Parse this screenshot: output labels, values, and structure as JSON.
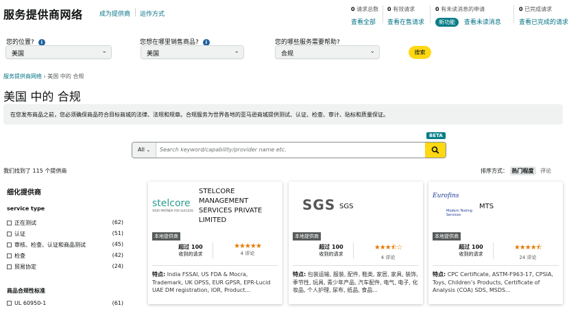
{
  "header": {
    "title": "服务提供商网络",
    "link1": "成为提供商",
    "link2": "运作方式",
    "stats": [
      {
        "count": "0",
        "label": "请求总数",
        "action": "查看全部"
      },
      {
        "count": "0",
        "label": "有效请求",
        "action": "查看在售请求"
      },
      {
        "count": "0",
        "label": "有未读消息的申请",
        "badge": "新功能",
        "action": "查看未读消息"
      },
      {
        "count": "0",
        "label": "已完成请求",
        "action": "查看已完成的请求"
      }
    ]
  },
  "filters": {
    "location_label": "您的位置?",
    "location_value": "美国",
    "market_label": "您想在哪里销售商品?",
    "market_value": "美国",
    "service_label": "您的哪些服务需要帮助?",
    "service_value": "合规",
    "search_button": "搜索"
  },
  "breadcrumb": {
    "root": "服务提供商网络",
    "sep": "›",
    "current": "美国 中的 合规"
  },
  "page_title": "美国 中的 合规",
  "banner": "在您发布商品之前，您必须确保商品符合目标商城的法律、法规和规章。合规服务为世界各地的亚马逊商城提供测试、认证、检查、审计、贴标和质量保证。",
  "search": {
    "scope": "All",
    "placeholder": "Search keyword/capability/provider name etc.",
    "beta": "BETA"
  },
  "results_count": "我们找到了 115 个提供商",
  "sort": {
    "label": "排序方式：",
    "selected": "热门程度",
    "other": "评论"
  },
  "sidebar": {
    "title": "细化提供商",
    "service_type_title": "service type",
    "service_types": [
      {
        "label": "正在测试",
        "count": "(62)"
      },
      {
        "label": "认证",
        "count": "(51)"
      },
      {
        "label": "审核、检查、认证和商品测试",
        "count": "(45)"
      },
      {
        "label": "检查",
        "count": "(42)"
      },
      {
        "label": "贸易协定",
        "count": "(24)"
      }
    ],
    "standard_title": "商品合规性标准",
    "standards": [
      {
        "label": "UL 60950-1",
        "count": "(61)"
      }
    ]
  },
  "cards": [
    {
      "logo_text": "stelcore",
      "logo_tagline": "YOUR PARTNER FOR SUCCESS",
      "name": "STELCORE MANAGEMENT SERVICES PRIVATE LIMITED",
      "local_badge": "本地提供商",
      "requests_value": "超过 100",
      "requests_label": "收到的请求",
      "rating": 5,
      "reviews": "4 评论",
      "features_label": "特点:",
      "features": "India FSSAI, US FDA & Mocra, Trademark, UK OPSS, EUR GPSR, EPR-Lucid UAE DM registration, IOR, Product..."
    },
    {
      "logo_text": "SGS",
      "name": "SGS",
      "local_badge": "本地提供商",
      "requests_value": "超过 100",
      "requests_label": "收到的请求",
      "rating": 3.5,
      "reviews": "4 评论",
      "features_label": "特点:",
      "features": "包装运输, 服装, 配件, 鞋类, 家居, 家具, 装饰, 季节性, 玩具, 青少年产品, 汽车配件, 电气, 电子, 化妆品, 个人护理, 尿布, 纸品, 食品..."
    },
    {
      "logo_text": "Eurofins",
      "logo_tagline": "Modern Testing Services",
      "name": "MTS",
      "local_badge": "本地提供商",
      "requests_value": "超过 100",
      "requests_label": "收到的请求",
      "rating": 4.5,
      "reviews": "24 评论",
      "features_label": "特点:",
      "features": "CPC Certificate, ASTM-F963-17, CPSIA, Toys, Children’s Products, Certificate of Analysis (COA) SDS, MSDS..."
    }
  ]
}
